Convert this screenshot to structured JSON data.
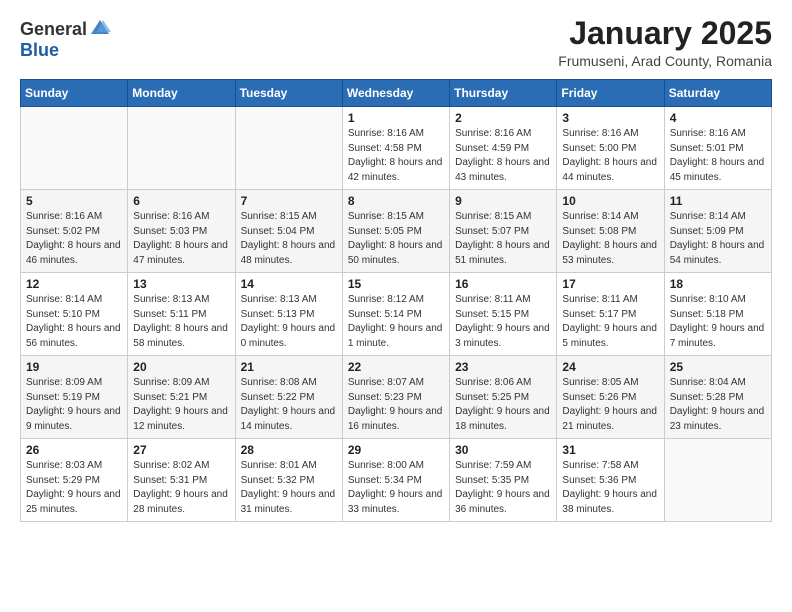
{
  "header": {
    "logo_general": "General",
    "logo_blue": "Blue",
    "title": "January 2025",
    "subtitle": "Frumuseni, Arad County, Romania"
  },
  "weekdays": [
    "Sunday",
    "Monday",
    "Tuesday",
    "Wednesday",
    "Thursday",
    "Friday",
    "Saturday"
  ],
  "weeks": [
    [
      {
        "day": "",
        "info": ""
      },
      {
        "day": "",
        "info": ""
      },
      {
        "day": "",
        "info": ""
      },
      {
        "day": "1",
        "info": "Sunrise: 8:16 AM\nSunset: 4:58 PM\nDaylight: 8 hours and 42 minutes."
      },
      {
        "day": "2",
        "info": "Sunrise: 8:16 AM\nSunset: 4:59 PM\nDaylight: 8 hours and 43 minutes."
      },
      {
        "day": "3",
        "info": "Sunrise: 8:16 AM\nSunset: 5:00 PM\nDaylight: 8 hours and 44 minutes."
      },
      {
        "day": "4",
        "info": "Sunrise: 8:16 AM\nSunset: 5:01 PM\nDaylight: 8 hours and 45 minutes."
      }
    ],
    [
      {
        "day": "5",
        "info": "Sunrise: 8:16 AM\nSunset: 5:02 PM\nDaylight: 8 hours and 46 minutes."
      },
      {
        "day": "6",
        "info": "Sunrise: 8:16 AM\nSunset: 5:03 PM\nDaylight: 8 hours and 47 minutes."
      },
      {
        "day": "7",
        "info": "Sunrise: 8:15 AM\nSunset: 5:04 PM\nDaylight: 8 hours and 48 minutes."
      },
      {
        "day": "8",
        "info": "Sunrise: 8:15 AM\nSunset: 5:05 PM\nDaylight: 8 hours and 50 minutes."
      },
      {
        "day": "9",
        "info": "Sunrise: 8:15 AM\nSunset: 5:07 PM\nDaylight: 8 hours and 51 minutes."
      },
      {
        "day": "10",
        "info": "Sunrise: 8:14 AM\nSunset: 5:08 PM\nDaylight: 8 hours and 53 minutes."
      },
      {
        "day": "11",
        "info": "Sunrise: 8:14 AM\nSunset: 5:09 PM\nDaylight: 8 hours and 54 minutes."
      }
    ],
    [
      {
        "day": "12",
        "info": "Sunrise: 8:14 AM\nSunset: 5:10 PM\nDaylight: 8 hours and 56 minutes."
      },
      {
        "day": "13",
        "info": "Sunrise: 8:13 AM\nSunset: 5:11 PM\nDaylight: 8 hours and 58 minutes."
      },
      {
        "day": "14",
        "info": "Sunrise: 8:13 AM\nSunset: 5:13 PM\nDaylight: 9 hours and 0 minutes."
      },
      {
        "day": "15",
        "info": "Sunrise: 8:12 AM\nSunset: 5:14 PM\nDaylight: 9 hours and 1 minute."
      },
      {
        "day": "16",
        "info": "Sunrise: 8:11 AM\nSunset: 5:15 PM\nDaylight: 9 hours and 3 minutes."
      },
      {
        "day": "17",
        "info": "Sunrise: 8:11 AM\nSunset: 5:17 PM\nDaylight: 9 hours and 5 minutes."
      },
      {
        "day": "18",
        "info": "Sunrise: 8:10 AM\nSunset: 5:18 PM\nDaylight: 9 hours and 7 minutes."
      }
    ],
    [
      {
        "day": "19",
        "info": "Sunrise: 8:09 AM\nSunset: 5:19 PM\nDaylight: 9 hours and 9 minutes."
      },
      {
        "day": "20",
        "info": "Sunrise: 8:09 AM\nSunset: 5:21 PM\nDaylight: 9 hours and 12 minutes."
      },
      {
        "day": "21",
        "info": "Sunrise: 8:08 AM\nSunset: 5:22 PM\nDaylight: 9 hours and 14 minutes."
      },
      {
        "day": "22",
        "info": "Sunrise: 8:07 AM\nSunset: 5:23 PM\nDaylight: 9 hours and 16 minutes."
      },
      {
        "day": "23",
        "info": "Sunrise: 8:06 AM\nSunset: 5:25 PM\nDaylight: 9 hours and 18 minutes."
      },
      {
        "day": "24",
        "info": "Sunrise: 8:05 AM\nSunset: 5:26 PM\nDaylight: 9 hours and 21 minutes."
      },
      {
        "day": "25",
        "info": "Sunrise: 8:04 AM\nSunset: 5:28 PM\nDaylight: 9 hours and 23 minutes."
      }
    ],
    [
      {
        "day": "26",
        "info": "Sunrise: 8:03 AM\nSunset: 5:29 PM\nDaylight: 9 hours and 25 minutes."
      },
      {
        "day": "27",
        "info": "Sunrise: 8:02 AM\nSunset: 5:31 PM\nDaylight: 9 hours and 28 minutes."
      },
      {
        "day": "28",
        "info": "Sunrise: 8:01 AM\nSunset: 5:32 PM\nDaylight: 9 hours and 31 minutes."
      },
      {
        "day": "29",
        "info": "Sunrise: 8:00 AM\nSunset: 5:34 PM\nDaylight: 9 hours and 33 minutes."
      },
      {
        "day": "30",
        "info": "Sunrise: 7:59 AM\nSunset: 5:35 PM\nDaylight: 9 hours and 36 minutes."
      },
      {
        "day": "31",
        "info": "Sunrise: 7:58 AM\nSunset: 5:36 PM\nDaylight: 9 hours and 38 minutes."
      },
      {
        "day": "",
        "info": ""
      }
    ]
  ]
}
